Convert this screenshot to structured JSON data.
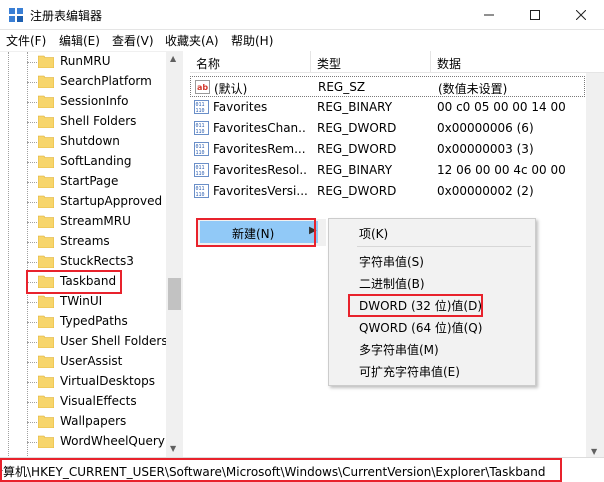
{
  "window": {
    "title": "注册表编辑器"
  },
  "menu": [
    "文件(F)",
    "编辑(E)",
    "查看(V)",
    "收藏夹(A)",
    "帮助(H)"
  ],
  "tree": {
    "items": [
      "RunMRU",
      "SearchPlatform",
      "SessionInfo",
      "Shell Folders",
      "Shutdown",
      "SoftLanding",
      "StartPage",
      "StartupApproved",
      "StreamMRU",
      "Streams",
      "StuckRects3",
      "Taskband",
      "TWinUI",
      "TypedPaths",
      "User Shell Folders",
      "UserAssist",
      "VirtualDesktops",
      "VisualEffects",
      "Wallpapers",
      "WordWheelQuery"
    ],
    "selected": "Taskband"
  },
  "list": {
    "headers": {
      "name": "名称",
      "type": "类型",
      "data": "数据"
    },
    "rows": [
      {
        "name": "(默认)",
        "type": "REG_SZ",
        "data": "(数值未设置)",
        "icon": "string-value-icon"
      },
      {
        "name": "Favorites",
        "type": "REG_BINARY",
        "data": "00 c0 05 00 00 14 00",
        "icon": "binary-value-icon"
      },
      {
        "name": "FavoritesChan...",
        "type": "REG_DWORD",
        "data": "0x00000006 (6)",
        "icon": "binary-value-icon"
      },
      {
        "name": "FavoritesRem...",
        "type": "REG_DWORD",
        "data": "0x00000003 (3)",
        "icon": "binary-value-icon"
      },
      {
        "name": "FavoritesResol...",
        "type": "REG_BINARY",
        "data": "12 06 00 00 4c 00 00",
        "icon": "binary-value-icon"
      },
      {
        "name": "FavoritesVersi...",
        "type": "REG_DWORD",
        "data": "0x00000002 (2)",
        "icon": "binary-value-icon"
      }
    ]
  },
  "context_menu": {
    "new_label": "新建(N)",
    "submenu": [
      "项(K)",
      "字符串值(S)",
      "二进制值(B)",
      "DWORD (32 位)值(D)",
      "QWORD (64 位)值(Q)",
      "多字符串值(M)",
      "可扩充字符串值(E)"
    ]
  },
  "status": {
    "path": "计算机\\HKEY_CURRENT_USER\\Software\\Microsoft\\Windows\\CurrentVersion\\Explorer\\Taskband"
  },
  "colors": {
    "highlight": "#91c9f7",
    "annotation": "#e8222c",
    "folder": "#f7d56b"
  }
}
